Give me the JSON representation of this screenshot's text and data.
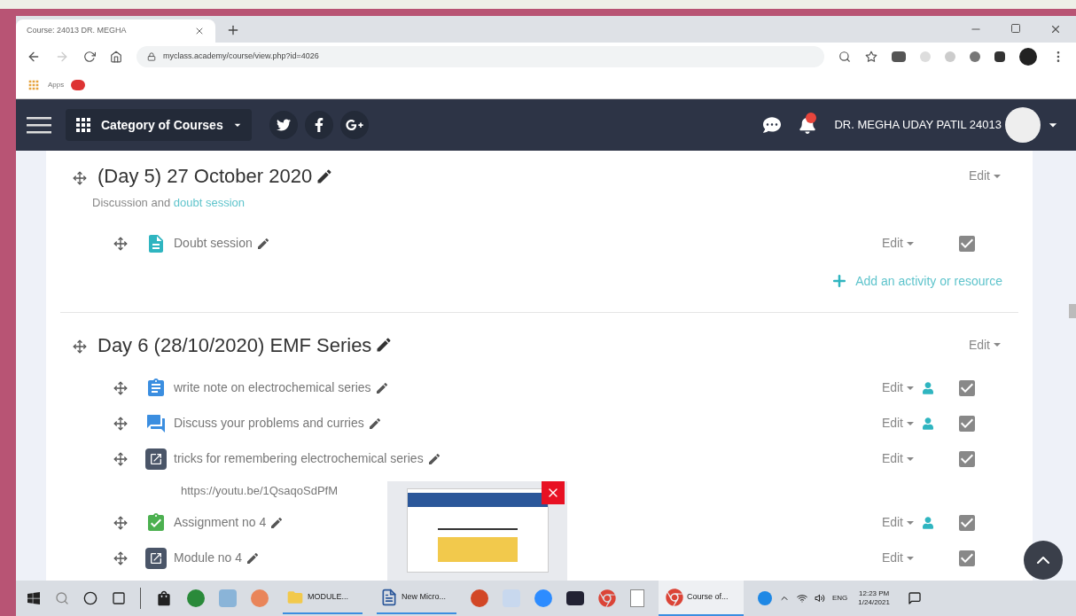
{
  "browser": {
    "tab_title": "Course: 24013 DR. MEGHA",
    "url": "myclass.academy/course/view.php?id=4026",
    "bookmarks": [
      "Apps"
    ]
  },
  "navbar": {
    "menu_label": "Category of Courses",
    "user_name": "DR. MEGHA UDAY PATIL 24013",
    "notification_badge": true
  },
  "sections": [
    {
      "title": "(Day 5) 27 October 2020",
      "summary_text": "Discussion and",
      "summary_link": "doubt session",
      "edit": "Edit",
      "activities": [
        {
          "kind": "page",
          "name": "Doubt session",
          "edit": "Edit",
          "restricted": false,
          "checked": true
        }
      ],
      "add_link": "Add an activity or resource"
    },
    {
      "title": "Day 6 (28/10/2020) EMF Series",
      "edit": "Edit",
      "activities": [
        {
          "kind": "assign",
          "name": "write note on electrochemical series",
          "edit": "Edit",
          "restricted": true,
          "checked": true
        },
        {
          "kind": "forum",
          "name": "Discuss your problems and curries",
          "edit": "Edit",
          "restricted": true,
          "checked": true
        },
        {
          "kind": "url",
          "name": "tricks for remembering electrochemical series",
          "edit": "Edit",
          "restricted": false,
          "checked": true,
          "link": "https://youtu.be/1QsaqoSdPfM"
        },
        {
          "kind": "assignment",
          "name": "Assignment no 4",
          "edit": "Edit",
          "restricted": true,
          "checked": true
        },
        {
          "kind": "url",
          "name": "Module no 4",
          "edit": "Edit",
          "restricted": false,
          "checked": true
        }
      ]
    }
  ],
  "taskbar": {
    "apps": [
      {
        "kind": "folder",
        "label": "MODULE..."
      },
      {
        "kind": "word",
        "label": "New Micro..."
      },
      {
        "kind": "chrome",
        "label": "Course of..."
      }
    ],
    "language": "ENG",
    "time": "12:23 PM",
    "date": "1/24/2021"
  }
}
